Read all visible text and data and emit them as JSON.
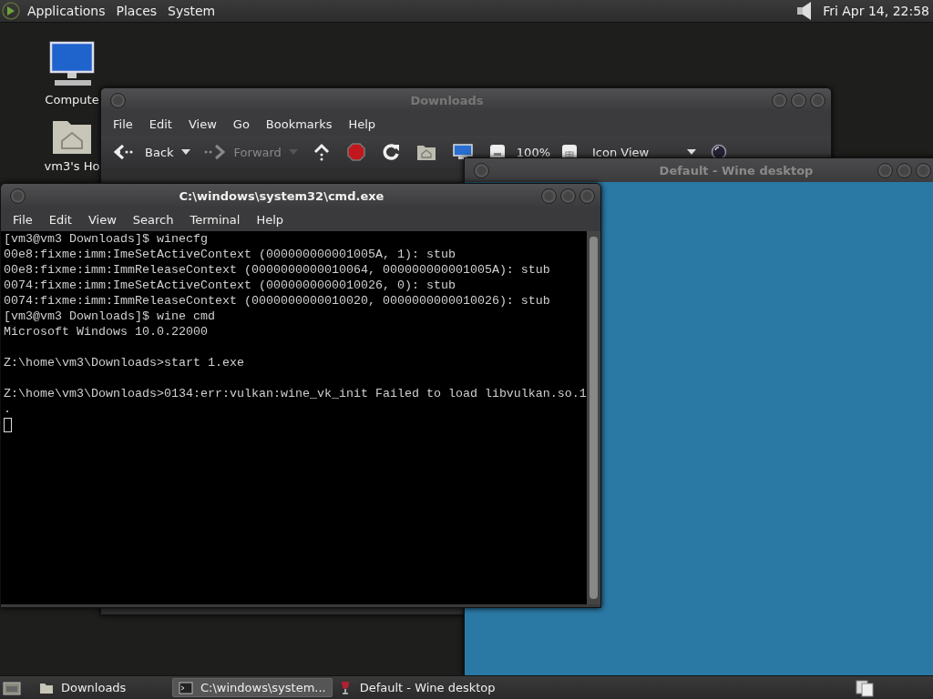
{
  "top_panel": {
    "menus": [
      "Applications",
      "Places",
      "System"
    ],
    "clock": "Fri Apr 14, 22:58"
  },
  "desktop_icons": [
    {
      "kind": "computer",
      "label": "Compute"
    },
    {
      "kind": "home",
      "label": "vm3's Ho"
    }
  ],
  "file_manager": {
    "title": "Downloads",
    "menu": [
      "File",
      "Edit",
      "View",
      "Go",
      "Bookmarks",
      "Help"
    ],
    "toolbar": [
      {
        "kind": "back",
        "label": "Back",
        "disabled": false
      },
      {
        "kind": "forward",
        "label": "Forward",
        "disabled": true
      },
      {
        "kind": "up"
      },
      {
        "kind": "stop"
      },
      {
        "kind": "reload"
      },
      {
        "kind": "home"
      },
      {
        "kind": "computer"
      },
      {
        "kind": "zoom-out"
      },
      {
        "kind": "zoom-level",
        "label": "100%"
      },
      {
        "kind": "zoom-in"
      },
      {
        "kind": "view",
        "label": "Icon View"
      },
      {
        "kind": "search"
      }
    ]
  },
  "wine_desktop": {
    "title": "Default - Wine desktop"
  },
  "terminal": {
    "title": "C:\\windows\\system32\\cmd.exe",
    "menu": [
      "File",
      "Edit",
      "View",
      "Search",
      "Terminal",
      "Help"
    ],
    "blocks": [
      [
        "[vm3@vm3 Downloads]$ winecfg",
        "00e8:fixme:imm:ImeSetActiveContext (000000000001005A, 1): stub",
        "00e8:fixme:imm:ImmReleaseContext (0000000000010064, 000000000001005A): stub",
        "0074:fixme:imm:ImeSetActiveContext (0000000000010026, 0): stub",
        "0074:fixme:imm:ImmReleaseContext (0000000000010020, 0000000000010026): stub",
        "[vm3@vm3 Downloads]$ wine cmd",
        "Microsoft Windows 10.0.22000"
      ],
      [
        "Z:\\home\\vm3\\Downloads>start 1.exe"
      ],
      [
        "Z:\\home\\vm3\\Downloads>0134:err:vulkan:wine_vk_init Failed to load libvulkan.so.1",
        "."
      ]
    ]
  },
  "taskbar": [
    {
      "kind": "folder",
      "label": "Downloads",
      "selected": false
    },
    {
      "kind": "terminal",
      "label": "C:\\windows\\system...",
      "selected": true
    },
    {
      "kind": "wine",
      "label": "Default - Wine desktop",
      "selected": false
    }
  ]
}
